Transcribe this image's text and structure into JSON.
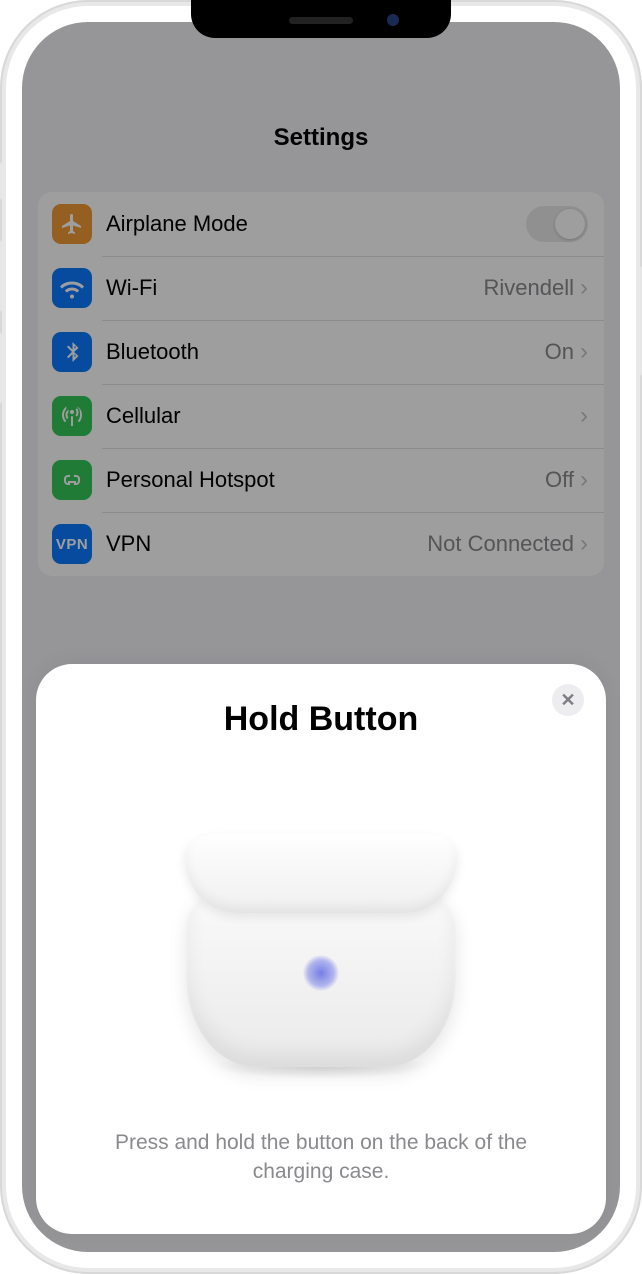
{
  "header": {
    "title": "Settings"
  },
  "settings": {
    "rows": [
      {
        "label": "Airplane Mode",
        "value": "",
        "toggle": "off"
      },
      {
        "label": "Wi-Fi",
        "value": "Rivendell"
      },
      {
        "label": "Bluetooth",
        "value": "On"
      },
      {
        "label": "Cellular",
        "value": ""
      },
      {
        "label": "Personal Hotspot",
        "value": "Off"
      },
      {
        "label": "VPN",
        "value": "Not Connected"
      }
    ],
    "vpn_icon_text": "VPN"
  },
  "sheet": {
    "title": "Hold Button",
    "description": "Press and hold the button on the back of the charging case.",
    "close_glyph": "✕"
  }
}
